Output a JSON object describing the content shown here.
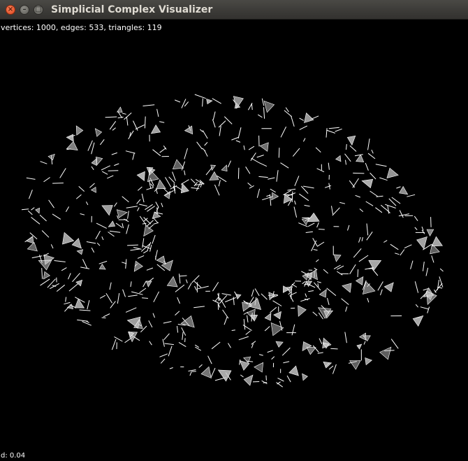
{
  "window": {
    "title": "Simplicial Complex Visualizer",
    "controls": {
      "close_icon": "close-icon",
      "minimize_icon": "minimize-icon",
      "maximize_icon": "maximize-icon"
    }
  },
  "overlay": {
    "stats_text": "vertices: 1000, edges: 533, triangles: 119",
    "status_text": "d: 0.04"
  },
  "complex": {
    "vertices": 1000,
    "edges": 533,
    "triangles": 119,
    "d": 0.04,
    "shape": "torus",
    "background_color": "#000000",
    "edge_color": "#ffffff",
    "triangle_color": "#c8c8c8"
  }
}
